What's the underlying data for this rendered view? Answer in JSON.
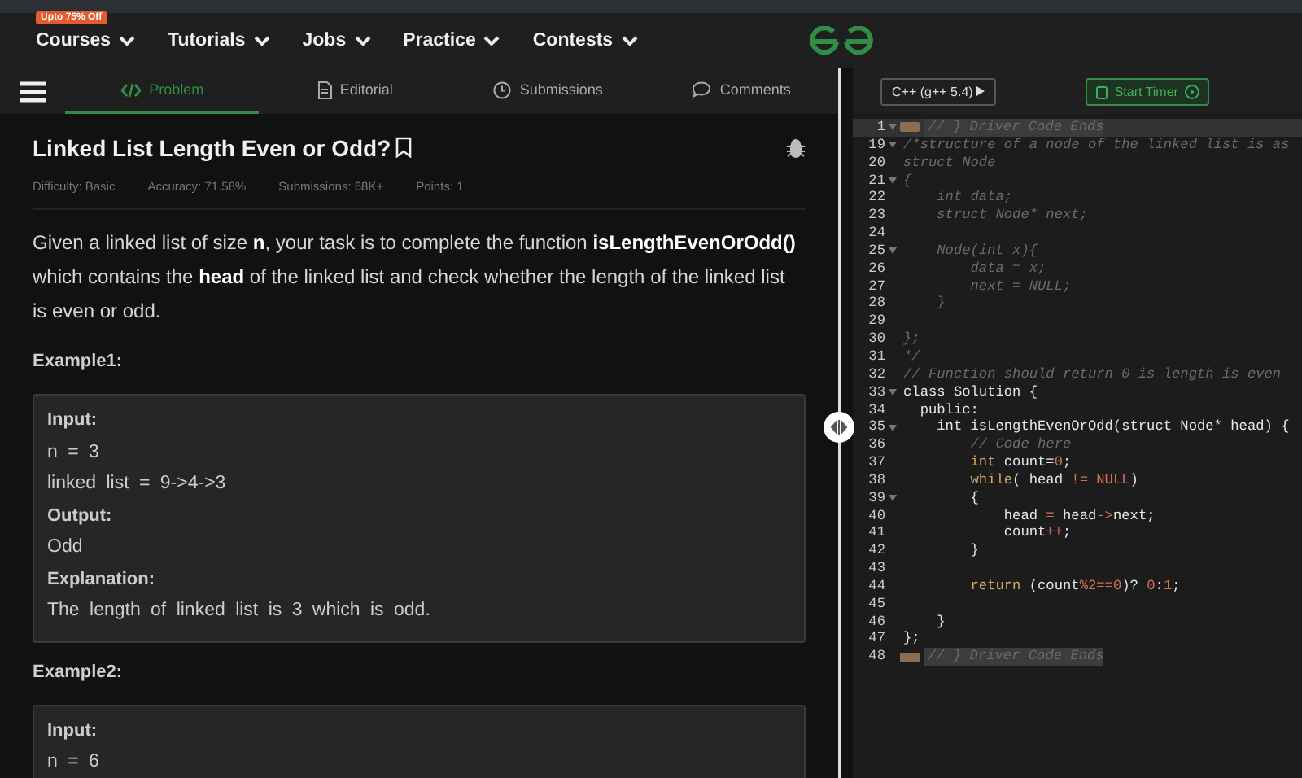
{
  "nav": {
    "items": [
      {
        "label": "Courses",
        "badge": "Upto 75% Off"
      },
      {
        "label": "Tutorials"
      },
      {
        "label": "Jobs"
      },
      {
        "label": "Practice"
      },
      {
        "label": "Contests"
      }
    ]
  },
  "tabs": [
    {
      "label": "Problem",
      "selected": true
    },
    {
      "label": "Editorial",
      "selected": false
    },
    {
      "label": "Submissions",
      "selected": false
    },
    {
      "label": "Comments",
      "selected": false
    }
  ],
  "problem": {
    "title": "Linked List Length Even or Odd?",
    "meta": [
      "Difficulty: Basic",
      "Accuracy: 71.58%",
      "Submissions: 68K+",
      "Points: 1"
    ],
    "description": "Given a linked list of size **n**, your task is to complete the function **isLengthEvenOrOdd()** which contains the **head** of the linked list and check whether the length of the linked list is even or odd.",
    "examples": [
      {
        "heading": "Example1:",
        "lines": [
          {
            "kind": "label",
            "text": "Input:"
          },
          {
            "kind": "text",
            "text": "n = 3"
          },
          {
            "kind": "text",
            "text": "linked list = 9->4->3"
          },
          {
            "kind": "label",
            "text": "Output:"
          },
          {
            "kind": "text",
            "text": "Odd"
          },
          {
            "kind": "label",
            "text": "Explanation:"
          },
          {
            "kind": "text",
            "text": "The length of linked list is 3 which is odd."
          }
        ]
      },
      {
        "heading": "Example2:",
        "lines": [
          {
            "kind": "label",
            "text": "Input:"
          },
          {
            "kind": "text",
            "text": "n = 6"
          }
        ]
      }
    ]
  },
  "editor": {
    "language": "C++ (g++ 5.4)",
    "timer_button": "Start Timer",
    "lines": [
      {
        "number": "1",
        "fold": true,
        "active": true,
        "collapsed": true,
        "tokens": [
          {
            "kind": "comment",
            "text": "// } Driver Code Ends"
          }
        ]
      },
      {
        "number": "19",
        "fold": true,
        "active": false,
        "collapsed": false,
        "tokens": [
          {
            "kind": "comment",
            "text": "/*structure of a node of the linked list is as"
          }
        ]
      },
      {
        "number": "20",
        "fold": false,
        "active": false,
        "collapsed": false,
        "tokens": [
          {
            "kind": "comment",
            "text": "struct Node"
          }
        ]
      },
      {
        "number": "21",
        "fold": true,
        "active": false,
        "collapsed": false,
        "tokens": [
          {
            "kind": "comment",
            "text": "{"
          }
        ]
      },
      {
        "number": "22",
        "fold": false,
        "active": false,
        "collapsed": false,
        "tokens": [
          {
            "kind": "comment",
            "text": "    int data;"
          }
        ]
      },
      {
        "number": "23",
        "fold": false,
        "active": false,
        "collapsed": false,
        "tokens": [
          {
            "kind": "comment",
            "text": "    struct Node* next;"
          }
        ]
      },
      {
        "number": "24",
        "fold": false,
        "active": false,
        "collapsed": false
      },
      {
        "number": "25",
        "fold": true,
        "active": false,
        "collapsed": false,
        "tokens": [
          {
            "kind": "comment",
            "text": "    Node(int x){"
          }
        ]
      },
      {
        "number": "26",
        "fold": false,
        "active": false,
        "collapsed": false,
        "tokens": [
          {
            "kind": "comment",
            "text": "        data = x;"
          }
        ]
      },
      {
        "number": "27",
        "fold": false,
        "active": false,
        "collapsed": false,
        "tokens": [
          {
            "kind": "comment",
            "text": "        next = NULL;"
          }
        ]
      },
      {
        "number": "28",
        "fold": false,
        "active": false,
        "collapsed": false,
        "tokens": [
          {
            "kind": "comment",
            "text": "    }"
          }
        ]
      },
      {
        "number": "29",
        "fold": false,
        "active": false,
        "collapsed": false
      },
      {
        "number": "30",
        "fold": false,
        "active": false,
        "collapsed": false,
        "tokens": [
          {
            "kind": "comment",
            "text": "};"
          }
        ]
      },
      {
        "number": "31",
        "fold": false,
        "active": false,
        "collapsed": false,
        "tokens": [
          {
            "kind": "comment",
            "text": "*/"
          }
        ]
      },
      {
        "number": "32",
        "fold": false,
        "active": false,
        "collapsed": false,
        "tokens": [
          {
            "kind": "comment",
            "text": "// Function should return 0 is length is even"
          }
        ]
      },
      {
        "number": "33",
        "fold": true,
        "active": false,
        "collapsed": false,
        "tokens": [
          {
            "kind": "plain",
            "text": "class Solution {"
          }
        ]
      },
      {
        "number": "34",
        "fold": false,
        "active": false,
        "collapsed": false,
        "tokens": [
          {
            "kind": "plain",
            "text": "  public:"
          }
        ]
      },
      {
        "number": "35",
        "fold": true,
        "active": false,
        "collapsed": false,
        "tokens": [
          {
            "kind": "plain",
            "text": "    int isLengthEvenOrOdd(struct Node* head) {"
          }
        ]
      },
      {
        "number": "36",
        "fold": false,
        "active": false,
        "collapsed": false,
        "tokens": [
          {
            "kind": "comment",
            "text": "        // Code here"
          }
        ]
      },
      {
        "number": "37",
        "fold": false,
        "active": false,
        "collapsed": false,
        "tokens": [
          {
            "kind": "keyword",
            "text": "        int"
          },
          {
            "kind": "plain",
            "text": " count="
          },
          {
            "kind": "constant",
            "text": "0"
          },
          {
            "kind": "plain",
            "text": ";"
          }
        ]
      },
      {
        "number": "38",
        "fold": false,
        "active": false,
        "collapsed": false,
        "tokens": [
          {
            "kind": "keyword",
            "text": "        while"
          },
          {
            "kind": "plain",
            "text": "( head "
          },
          {
            "kind": "constant",
            "text": "!= NULL"
          },
          {
            "kind": "plain",
            "text": ")"
          }
        ]
      },
      {
        "number": "39",
        "fold": true,
        "active": false,
        "collapsed": false,
        "tokens": [
          {
            "kind": "plain",
            "text": "        {"
          }
        ]
      },
      {
        "number": "40",
        "fold": false,
        "active": false,
        "collapsed": false,
        "tokens": [
          {
            "kind": "plain",
            "text": "            head "
          },
          {
            "kind": "constant",
            "text": "="
          },
          {
            "kind": "plain",
            "text": " head"
          },
          {
            "kind": "constant",
            "text": "->"
          },
          {
            "kind": "plain",
            "text": "next;"
          }
        ]
      },
      {
        "number": "41",
        "fold": false,
        "active": false,
        "collapsed": false,
        "tokens": [
          {
            "kind": "plain",
            "text": "            count"
          },
          {
            "kind": "constant",
            "text": "++"
          },
          {
            "kind": "plain",
            "text": ";"
          }
        ]
      },
      {
        "number": "42",
        "fold": false,
        "active": false,
        "collapsed": false,
        "tokens": [
          {
            "kind": "plain",
            "text": "        }"
          }
        ]
      },
      {
        "number": "43",
        "fold": false,
        "active": false,
        "collapsed": false
      },
      {
        "number": "44",
        "fold": false,
        "active": false,
        "collapsed": false,
        "tokens": [
          {
            "kind": "keyword",
            "text": "        return"
          },
          {
            "kind": "plain",
            "text": " (count"
          },
          {
            "kind": "constant",
            "text": "%2==0"
          },
          {
            "kind": "plain",
            "text": ")? "
          },
          {
            "kind": "constant",
            "text": "0"
          },
          {
            "kind": "plain",
            "text": ":"
          },
          {
            "kind": "constant",
            "text": "1"
          },
          {
            "kind": "plain",
            "text": ";"
          }
        ]
      },
      {
        "number": "45",
        "fold": false,
        "active": false,
        "collapsed": false
      },
      {
        "number": "46",
        "fold": false,
        "active": false,
        "collapsed": false,
        "tokens": [
          {
            "kind": "plain",
            "text": "    }"
          }
        ]
      },
      {
        "number": "47",
        "fold": false,
        "active": false,
        "collapsed": false,
        "tokens": [
          {
            "kind": "plain",
            "text": "};"
          }
        ]
      },
      {
        "number": "48",
        "fold": false,
        "active": false,
        "collapsed": true,
        "tokens": [
          {
            "kind": "comment",
            "text": "// } Driver Code Ends"
          }
        ]
      }
    ]
  }
}
